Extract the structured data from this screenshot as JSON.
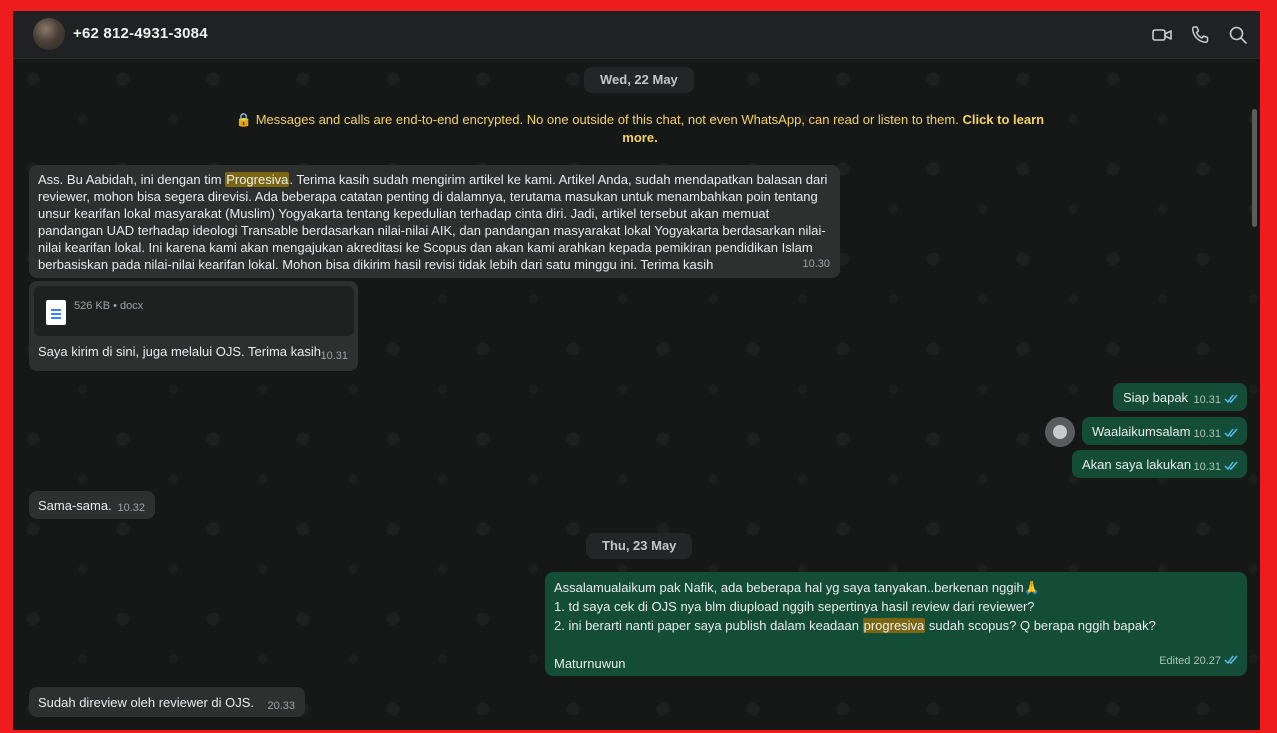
{
  "header": {
    "contact": "+62 812-4931-3084",
    "icons": [
      "video-call-icon",
      "voice-call-icon",
      "search-icon"
    ]
  },
  "chat": {
    "date1": "Wed, 22 May",
    "encryption": {
      "text": "Messages and calls are end-to-end encrypted. No one outside of this chat, not even WhatsApp, can read or listen to them.",
      "link": "Click to learn more."
    },
    "msg1": {
      "pre": "Ass. Bu Aabidah, ini dengan tim ",
      "highlight": "Progresiva",
      "post": ". Terima kasih sudah mengirim artikel ke kami. Artikel Anda, sudah mendapatkan balasan dari reviewer, mohon bisa segera direvisi. Ada beberapa catatan penting di dalamnya, terutama masukan untuk menambahkan poin tentang unsur kearifan lokal masyarakat (Muslim) Yogyakarta tentang kepedulian terhadap cinta diri. Jadi, artikel tersebut akan memuat pandangan UAD terhadap ideologi Transable berdasarkan nilai-nilai AIK, dan pandangan masyarakat lokal Yogyakarta berdasarkan nilai-nilai kearifan lokal. Ini karena kami akan mengajukan akreditasi ke Scopus dan akan kami arahkan kepada pemikiran pendidikan Islam berbasiskan pada nilai-nilai kearifan lokal. Mohon bisa dikirim hasil revisi tidak lebih dari satu minggu ini. Terima kasih",
      "time": "10.30"
    },
    "msg2": {
      "file_meta": "526 KB • docx",
      "text": "Saya kirim di sini, juga melalui OJS. Terima kasih",
      "time": "10.31"
    },
    "out1": {
      "text": "Siap bapak",
      "time": "10.31"
    },
    "out2": {
      "text": "Waalaikumsalam",
      "time": "10.31"
    },
    "out3": {
      "text": "Akan saya lakukan",
      "time": "10.31"
    },
    "msg3": {
      "text": "Sama-sama.",
      "time": "10.32"
    },
    "date2": "Thu, 23 May",
    "out4": {
      "line1": "Assalamualaikum pak Nafik, ada beberapa hal yg saya tanyakan..berkenan nggih",
      "emoji": "🙏",
      "line2": "1. td saya cek di OJS nya blm diupload nggih sepertinya hasil review dari reviewer?",
      "line3_pre": "2. ini berarti nanti paper saya publish dalam keadaan ",
      "line3_hl": "progresiva",
      "line3_post": " sudah scopus? Q berapa nggih bapak?",
      "line4": "Maturnuwun",
      "edited": "Edited",
      "time": "20.27"
    },
    "msg4": {
      "text": "Sudah direview oleh reviewer di OJS.",
      "time": "20.33"
    }
  }
}
